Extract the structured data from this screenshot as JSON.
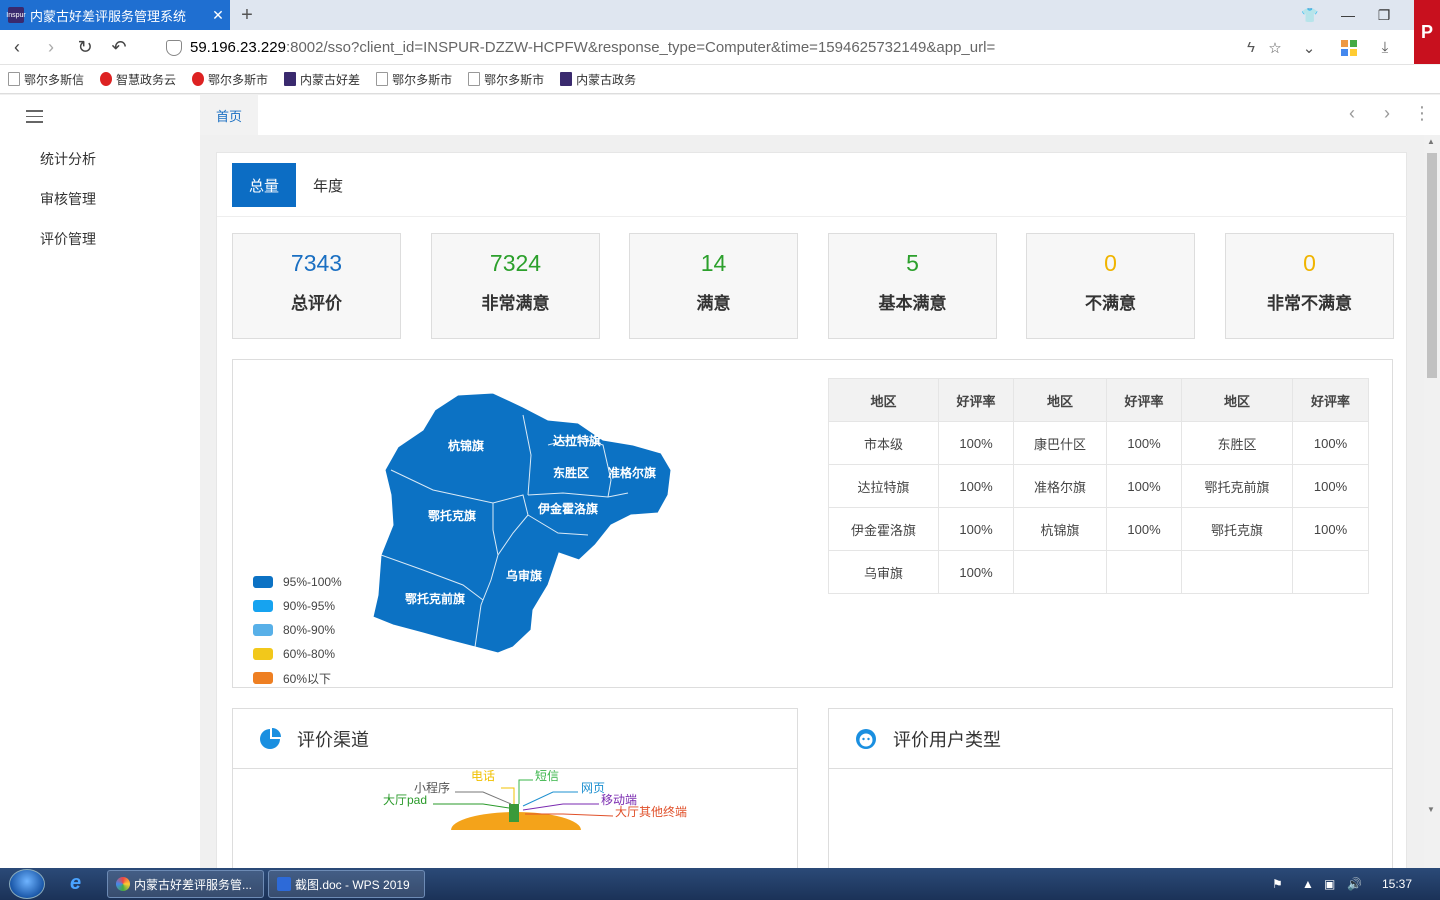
{
  "browser": {
    "tab_title": "内蒙古好差评服务管理系统",
    "tab_favicon": "Inspur",
    "url_host": "59.196.23.229",
    "url_rest": ":8002/sso?client_id=INSPUR-DZZW-HCPFW&response_type=Computer&time=1594625732149&app_url=",
    "bookmarks": [
      "鄂尔多斯信",
      "智慧政务云",
      "鄂尔多斯市",
      "内蒙古好差",
      "鄂尔多斯市",
      "鄂尔多斯市",
      "内蒙古政务"
    ]
  },
  "sidebar": {
    "items": [
      "统计分析",
      "审核管理",
      "评价管理"
    ]
  },
  "topnav": {
    "home_tab": "首页"
  },
  "subtabs": [
    "总量",
    "年度"
  ],
  "stats": [
    {
      "value": "7343",
      "label": "总评价",
      "color": "#1a6fc2"
    },
    {
      "value": "7324",
      "label": "非常满意",
      "color": "#2ca02c"
    },
    {
      "value": "14",
      "label": "满意",
      "color": "#2ca02c"
    },
    {
      "value": "5",
      "label": "基本满意",
      "color": "#2ca02c"
    },
    {
      "value": "0",
      "label": "不满意",
      "color": "#f0b400"
    },
    {
      "value": "0",
      "label": "非常不满意",
      "color": "#f0b400"
    }
  ],
  "map": {
    "regions": [
      "杭锦旗",
      "达拉特旗",
      "东胜区",
      "准格尔旗",
      "鄂托克旗",
      "伊金霍洛旗",
      "乌审旗",
      "鄂托克前旗"
    ],
    "fill": "#0c72c4",
    "legend": [
      {
        "label": "95%-100%",
        "color": "#0c72c4"
      },
      {
        "label": "90%-95%",
        "color": "#16a3f0"
      },
      {
        "label": "80%-90%",
        "color": "#58b0e8"
      },
      {
        "label": "60%-80%",
        "color": "#f2c81b"
      },
      {
        "label": "60%以下",
        "color": "#ee7f22"
      }
    ]
  },
  "rate_table": {
    "headers": [
      "地区",
      "好评率",
      "地区",
      "好评率",
      "地区",
      "好评率"
    ],
    "rows": [
      [
        "市本级",
        "100%",
        "康巴什区",
        "100%",
        "东胜区",
        "100%"
      ],
      [
        "达拉特旗",
        "100%",
        "准格尔旗",
        "100%",
        "鄂托克前旗",
        "100%"
      ],
      [
        "伊金霍洛旗",
        "100%",
        "杭锦旗",
        "100%",
        "鄂托克旗",
        "100%"
      ],
      [
        "乌审旗",
        "100%",
        "",
        "",
        "",
        ""
      ]
    ]
  },
  "panels": {
    "channel_title": "评价渠道",
    "usertype_title": "评价用户类型",
    "channel_labels": [
      {
        "text": "电话",
        "color": "#f0c000"
      },
      {
        "text": "短信",
        "color": "#3ab54a"
      },
      {
        "text": "小程序",
        "color": "#555555"
      },
      {
        "text": "网页",
        "color": "#1e90d0"
      },
      {
        "text": "大厅pad",
        "color": "#2a9a2a"
      },
      {
        "text": "移动端",
        "color": "#7a2ab0"
      },
      {
        "text": "大厅其他终端",
        "color": "#e0502a"
      }
    ]
  },
  "taskbar": {
    "tasks": [
      "内蒙古好差评服务管...",
      "截图.doc - WPS 2019"
    ],
    "clock": "15:37"
  }
}
